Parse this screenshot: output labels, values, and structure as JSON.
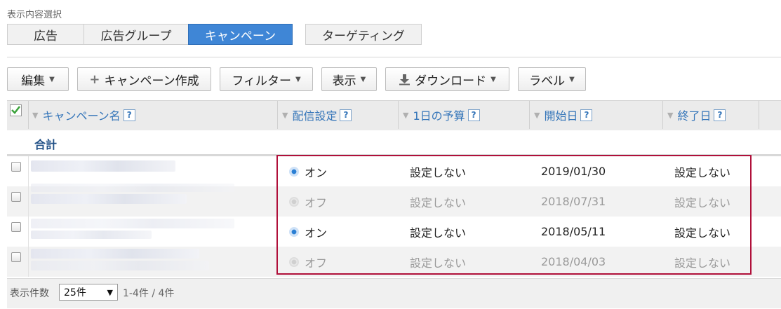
{
  "section_label": "表示内容選択",
  "view_tabs": [
    "広告",
    "広告グループ",
    "キャンペーン",
    "ターゲティング"
  ],
  "toolbar": {
    "edit": "編集",
    "create_campaign": "キャンペーン作成",
    "filter": "フィルター",
    "display": "表示",
    "download": "ダウンロード",
    "label": "ラベル"
  },
  "columns": {
    "name": "キャンペーン名",
    "delivery": "配信設定",
    "daily_budget": "1日の予算",
    "start_date": "開始日",
    "end_date": "終了日",
    "help": "?"
  },
  "total_label": "合計",
  "rows": [
    {
      "status": "オン",
      "budget": "設定しない",
      "start": "2019/01/30",
      "end": "設定しない"
    },
    {
      "status": "オフ",
      "budget": "設定しない",
      "start": "2018/07/31",
      "end": "設定しない"
    },
    {
      "status": "オン",
      "budget": "設定しない",
      "start": "2018/05/11",
      "end": "設定しない"
    },
    {
      "status": "オフ",
      "budget": "設定しない",
      "start": "2018/04/03",
      "end": "設定しない"
    }
  ],
  "footer": {
    "per_page_label": "表示件数",
    "per_page_value": "25件",
    "range": "1-4件 / 4件"
  },
  "colors": {
    "accent": "#3f86d6",
    "highlight": "#b0103a"
  }
}
